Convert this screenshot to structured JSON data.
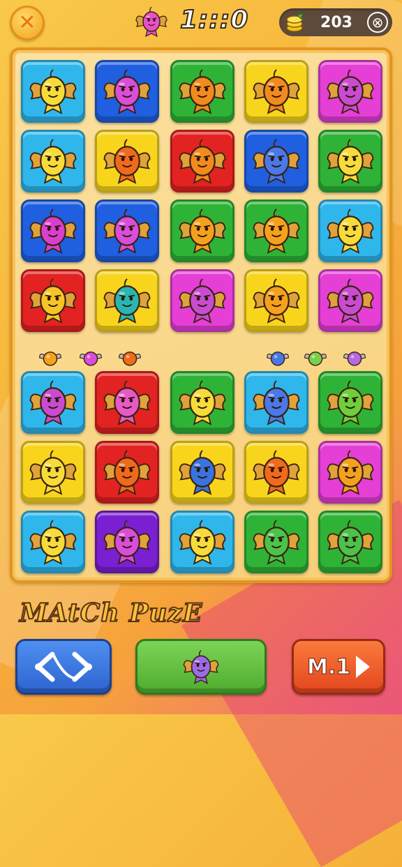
{
  "header": {
    "close_symbol": "✕",
    "score": "1:::0",
    "coins": "203",
    "coin_close_symbol": "⊗",
    "creature_color": "#e94fc8"
  },
  "palette": {
    "cyan": "#2fb7ec",
    "blue": "#1f5fe0",
    "green": "#2fb336",
    "yellow": "#f8d51c",
    "magenta": "#e53fd6",
    "red": "#e32222",
    "purple": "#7a1fd1"
  },
  "board": {
    "rows": [
      [
        {
          "tile": "cyan",
          "creature": "#f6dc3a"
        },
        {
          "tile": "blue",
          "creature": "#d94ed9"
        },
        {
          "tile": "green",
          "creature": "#f28a1e"
        },
        {
          "tile": "yellow",
          "creature": "#f28a1e"
        },
        {
          "tile": "magenta",
          "creature": "#c84ccf"
        }
      ],
      [
        {
          "tile": "cyan",
          "creature": "#f6dc3a"
        },
        {
          "tile": "yellow",
          "creature": "#f06a1c"
        },
        {
          "tile": "red",
          "creature": "#f28a1e"
        },
        {
          "tile": "blue",
          "creature": "#4a78e8"
        },
        {
          "tile": "green",
          "creature": "#f6dc3a"
        }
      ],
      [
        {
          "tile": "blue",
          "creature": "#d93fcf"
        },
        {
          "tile": "blue",
          "creature": "#d94ed9"
        },
        {
          "tile": "green",
          "creature": "#f5a11e"
        },
        {
          "tile": "green",
          "creature": "#f5a11e"
        },
        {
          "tile": "cyan",
          "creature": "#f6dc3a"
        }
      ],
      [
        {
          "tile": "red",
          "creature": "#f6c426"
        },
        {
          "tile": "yellow",
          "creature": "#2ab6b0"
        },
        {
          "tile": "magenta",
          "creature": "#c84ccf"
        },
        {
          "tile": "yellow",
          "creature": "#f5a11e"
        },
        {
          "tile": "magenta",
          "creature": "#c84ccf"
        }
      ],
      [
        {
          "tile": "cyan",
          "creature": "#c84ccf"
        },
        {
          "tile": "red",
          "creature": "#e859c7"
        },
        {
          "tile": "green",
          "creature": "#f6dc3a"
        },
        {
          "tile": "cyan",
          "creature": "#4a78e8"
        },
        {
          "tile": "green",
          "creature": "#6fcf3a"
        }
      ],
      [
        {
          "tile": "yellow",
          "creature": "#f6dc3a"
        },
        {
          "tile": "red",
          "creature": "#f06a1c"
        },
        {
          "tile": "yellow",
          "creature": "#3a72e0"
        },
        {
          "tile": "yellow",
          "creature": "#f06a1c"
        },
        {
          "tile": "magenta",
          "creature": "#f5a11e"
        }
      ],
      [
        {
          "tile": "cyan",
          "creature": "#f6dc3a"
        },
        {
          "tile": "purple",
          "creature": "#d94ed9"
        },
        {
          "tile": "cyan",
          "creature": "#f6dc3a"
        },
        {
          "tile": "green",
          "creature": "#4cc24a"
        },
        {
          "tile": "green",
          "creature": "#4cc24a"
        }
      ]
    ],
    "mini_pieces": [
      {
        "color": "#f5a11e"
      },
      {
        "color": "#d94ed9"
      },
      {
        "color": "#f06a1c"
      },
      {
        "color": "#4a78e8"
      },
      {
        "color": "#7ad04a"
      },
      {
        "color": "#b868e0"
      }
    ]
  },
  "footer": {
    "title": "MAtCh PuzE",
    "nav_icon": "swap-arrows-icon",
    "play_creature_color": "#9b6ae8",
    "level_label": "M.1"
  }
}
